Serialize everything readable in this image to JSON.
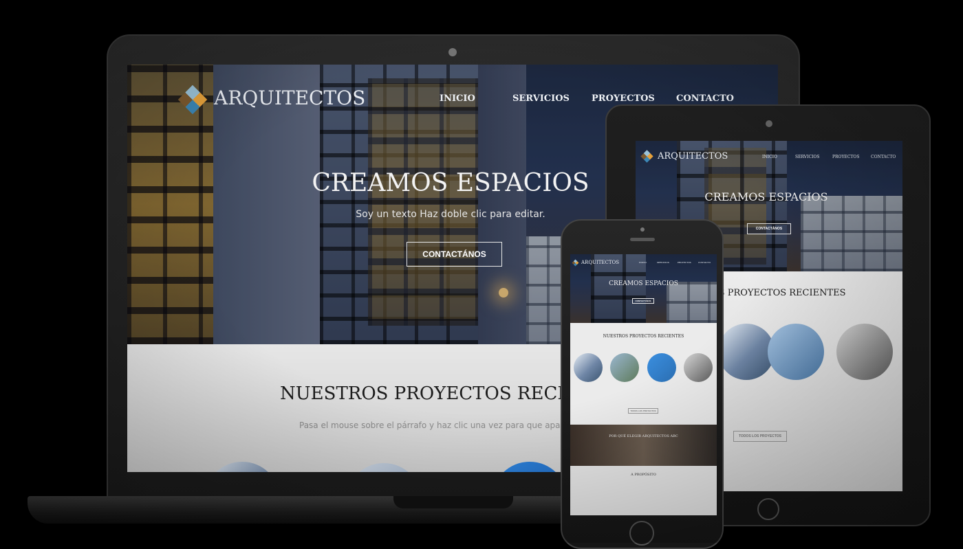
{
  "brand": {
    "name": "ARQUITECTOS"
  },
  "nav": {
    "items": [
      {
        "label": "INICIO"
      },
      {
        "label": "SERVICIOS"
      },
      {
        "label": "PROYECTOS"
      },
      {
        "label": "CONTACTO"
      }
    ]
  },
  "hero": {
    "title": "CREAMOS ESPACIOS",
    "subtitle": "Soy un texto Haz doble clic para editar.",
    "cta_label": "CONTACTÁNOS"
  },
  "projects": {
    "title_laptop": "NUESTROS PROYECTOS RECI",
    "subtitle_laptop": "Pasa el mouse sobre el párrafo y haz clic una vez para que apare",
    "title_tablet": "OS PROYECTOS RECIENTES",
    "title_phone": "NUESTROS PROYECTOS RECIENTES",
    "all_projects_label": "TODOS LOS PROYECTOS"
  },
  "why": {
    "title": "POR QUÉ ELEGIR ARQUITECTOS ABC"
  },
  "about": {
    "title": "A PROPÓSITO"
  },
  "colors": {
    "logo_orange": "#e7a23b",
    "logo_blue": "#3c87b6",
    "device_frame": "#1c1c1c",
    "background": "#000000"
  }
}
